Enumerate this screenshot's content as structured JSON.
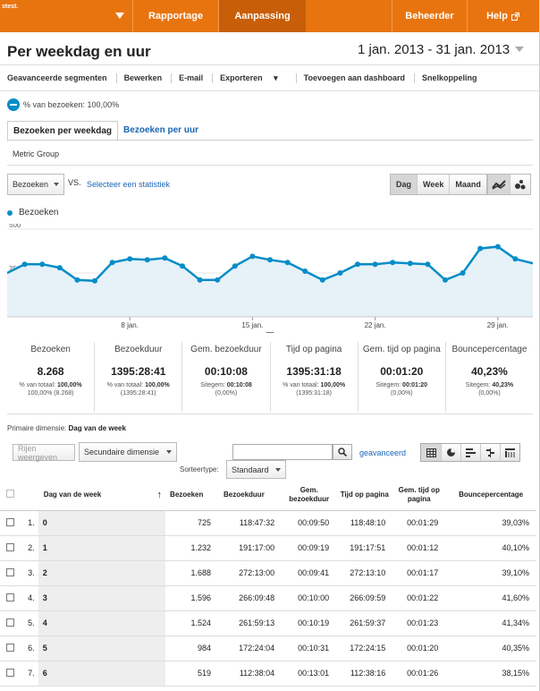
{
  "topbar": {
    "brand": "stest.",
    "nav": [
      "Rapportage",
      "Aanpassing",
      "Beheerder",
      "Help"
    ],
    "active": "Aanpassing"
  },
  "page": {
    "title": "Per weekdag en uur",
    "date_range": "1 jan. 2013 - 31 jan. 2013"
  },
  "toolbar": {
    "segments_label": "Geavanceerde segmenten",
    "edit_label": "Bewerken",
    "email_label": "E-mail",
    "export_label": "Exporteren",
    "dashboard_label": "Toevoegen aan dashboard",
    "shortcut_label": "Snelkoppeling"
  },
  "segment": {
    "label": "% van bezoeken: 100,00%"
  },
  "tabs": [
    "Bezoeken per weekdag",
    "Bezoeken per uur"
  ],
  "metric_group": "Metric Group",
  "chart_controls": {
    "metric_select": "Bezoeken",
    "vs": "VS.",
    "select_stat": "Selecteer een statistiek",
    "period_buttons": [
      "Dag",
      "Week",
      "Maand"
    ],
    "active_period": "Dag",
    "legend": "Bezoeken"
  },
  "chart_data": {
    "type": "area",
    "series": [
      {
        "name": "Bezoeken",
        "values": [
          250,
          300,
          300,
          280,
          210,
          205,
          310,
          330,
          325,
          335,
          290,
          210,
          210,
          290,
          345,
          325,
          310,
          260,
          210,
          250,
          300,
          300,
          310,
          305,
          300,
          210,
          250,
          390,
          400,
          330,
          305
        ]
      }
    ],
    "x_tick_labels": [
      "8 jan.",
      "15 jan.",
      "22 jan.",
      "29 jan."
    ],
    "y_tick_labels": [
      "500",
      "250"
    ],
    "ylim": [
      0,
      500
    ],
    "color": "#058dc7"
  },
  "summary": [
    {
      "label": "Bezoeken",
      "value": "8.268",
      "sub1": "% van totaal:",
      "sub1b": "100,00%",
      "sub2": "100,00% (8.268)"
    },
    {
      "label": "Bezoekduur",
      "value": "1395:28:41",
      "sub1": "% van totaal:",
      "sub1b": "100,00%",
      "sub2": "(1395:28:41)"
    },
    {
      "label": "Gem. bezoekduur",
      "value": "00:10:08",
      "sub1": "Sitegem:",
      "sub1b": "00:10:08",
      "sub2": "(0,00%)"
    },
    {
      "label": "Tijd op pagina",
      "value": "1395:31:18",
      "sub1": "% van totaal:",
      "sub1b": "100,00%",
      "sub2": "(1395:31:18)"
    },
    {
      "label": "Gem. tijd op pagina",
      "value": "00:01:20",
      "sub1": "Sitegem:",
      "sub1b": "00:01:20",
      "sub2": "(0,00%)"
    },
    {
      "label": "Bouncepercentage",
      "value": "40,23%",
      "sub1": "Sitegem:",
      "sub1b": "40,23%",
      "sub2": "(0,00%)"
    }
  ],
  "table_controls": {
    "primary_dimension_label": "Primaire dimensie:",
    "primary_dimension_value": "Dag van de week",
    "plot_rows": "Rijen weergeven",
    "secondary_dimension": "Secundaire dimensie",
    "search_placeholder": "",
    "advanced": "geavanceerd",
    "sort_type_label": "Sorteertype:",
    "sort_type_value": "Standaard"
  },
  "table": {
    "columns": [
      "Dag van de week",
      "Bezoeken",
      "Bezoekduur",
      "Gem. bezoekduur",
      "Tijd op pagina",
      "Gem. tijd op pagina",
      "Bouncepercentage"
    ],
    "rows": [
      [
        "1.",
        "0",
        "725",
        "118:47:32",
        "00:09:50",
        "118:48:10",
        "00:01:29",
        "39,03%"
      ],
      [
        "2.",
        "1",
        "1.232",
        "191:17:00",
        "00:09:19",
        "191:17:51",
        "00:01:12",
        "40,10%"
      ],
      [
        "3.",
        "2",
        "1.688",
        "272:13:00",
        "00:09:41",
        "272:13:10",
        "00:01:17",
        "39,10%"
      ],
      [
        "4.",
        "3",
        "1.596",
        "266:09:48",
        "00:10:00",
        "266:09:59",
        "00:01:22",
        "41,60%"
      ],
      [
        "5.",
        "4",
        "1.524",
        "261:59:13",
        "00:10:19",
        "261:59:37",
        "00:01:23",
        "41,34%"
      ],
      [
        "6.",
        "5",
        "984",
        "172:24:04",
        "00:10:31",
        "172:24:15",
        "00:01:20",
        "40,35%"
      ],
      [
        "7.",
        "6",
        "519",
        "112:38:04",
        "00:13:01",
        "112:38:16",
        "00:01:26",
        "38,15%"
      ]
    ]
  }
}
